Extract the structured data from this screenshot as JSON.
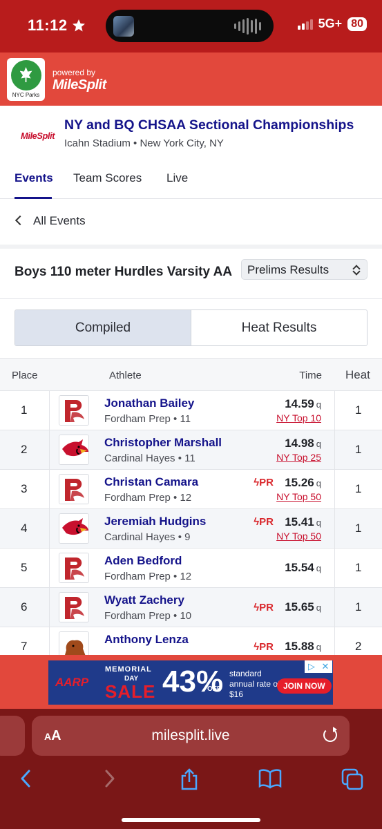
{
  "status_bar": {
    "time": "11:12",
    "network": "5G+",
    "battery": "80"
  },
  "brand": {
    "partner": "NYC Parks",
    "powered_by": "powered by",
    "provider": "MileSplit"
  },
  "meet": {
    "logo_text": "MileSplit",
    "title": "NY and BQ CHSAA Sectional Championships",
    "subtitle": "Icahn Stadium • New York City, NY"
  },
  "tabs": [
    "Events",
    "Team Scores",
    "Live"
  ],
  "nav": {
    "back_label": "All Events"
  },
  "event": {
    "title": "Boys 110 meter Hurdles Varsity AA",
    "round_select": "Prelims Results"
  },
  "view_toggle": {
    "compiled": "Compiled",
    "heat_results": "Heat Results"
  },
  "table": {
    "headers": {
      "place": "Place",
      "athlete": "Athlete",
      "time": "Time",
      "heat": "Heat"
    },
    "rows": [
      {
        "place": "1",
        "name": "Jonathan Bailey",
        "school": "Fordham Prep • 11",
        "pr": "",
        "time": "14.59",
        "qual": "q",
        "rank": "NY Top 10",
        "heat": "1",
        "team": "fordham"
      },
      {
        "place": "2",
        "name": "Christopher Marshall",
        "school": "Cardinal Hayes • 11",
        "pr": "",
        "time": "14.98",
        "qual": "q",
        "rank": "NY Top 25",
        "heat": "1",
        "team": "cardinal"
      },
      {
        "place": "3",
        "name": "Christan Camara",
        "school": "Fordham Prep • 12",
        "pr": "PR",
        "time": "15.26",
        "qual": "q",
        "rank": "NY Top 50",
        "heat": "1",
        "team": "fordham"
      },
      {
        "place": "4",
        "name": "Jeremiah Hudgins",
        "school": "Cardinal Hayes • 9",
        "pr": "PR",
        "time": "15.41",
        "qual": "q",
        "rank": "NY Top 50",
        "heat": "1",
        "team": "cardinal"
      },
      {
        "place": "5",
        "name": "Aden Bedford",
        "school": "Fordham Prep • 12",
        "pr": "",
        "time": "15.54",
        "qual": "q",
        "rank": "",
        "heat": "1",
        "team": "fordham"
      },
      {
        "place": "6",
        "name": "Wyatt Zachery",
        "school": "Fordham Prep • 10",
        "pr": "PR",
        "time": "15.65",
        "qual": "q",
        "rank": "",
        "heat": "1",
        "team": "fordham"
      },
      {
        "place": "7",
        "name": "Anthony Lenza",
        "school": "",
        "pr": "PR",
        "time": "15.88",
        "qual": "q",
        "rank": "",
        "heat": "2",
        "team": "lion"
      }
    ]
  },
  "ad": {
    "brand": "AARP",
    "line1": "MEMORIAL",
    "line2": "DAY",
    "line3": "SALE",
    "percent": "43%",
    "off": "OFF",
    "copy": "standard annual rate of $16",
    "cta": "JOIN NOW"
  },
  "browser": {
    "text_size": "AA",
    "url": "milesplit.live"
  },
  "colors": {
    "header_red": "#b81c1c",
    "brand_red": "#e2483c",
    "navy": "#14138a",
    "link_red": "#c8102e",
    "chrome": "#7a1717"
  }
}
